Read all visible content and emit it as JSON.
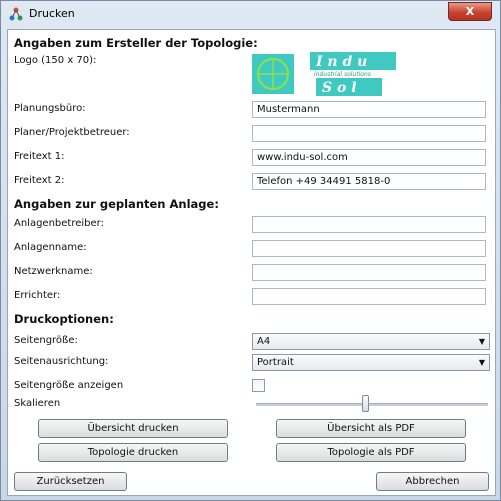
{
  "window": {
    "title": "Drucken",
    "close_label": "X"
  },
  "section_creator": "Angaben zum Ersteller der Topologie:",
  "logo_label": "Logo (150 x 70):",
  "logo": {
    "line1": "I n d u",
    "tagline": "industrial solutions",
    "line2": "S o l"
  },
  "creator_fields": [
    {
      "label": "Planungsbüro:",
      "value": "Mustermann"
    },
    {
      "label": "Planer/Projektbetreuer:",
      "value": ""
    },
    {
      "label": "Freitext 1:",
      "value": "www.indu-sol.com"
    },
    {
      "label": "Freitext 2:",
      "value": "Telefon +49 34491 5818-0"
    }
  ],
  "section_plant": "Angaben zur geplanten Anlage:",
  "plant_fields": [
    {
      "label": "Anlagenbetreiber:",
      "value": ""
    },
    {
      "label": "Anlagenname:",
      "value": ""
    },
    {
      "label": "Netzwerkname:",
      "value": ""
    },
    {
      "label": "Errichter:",
      "value": ""
    }
  ],
  "section_print": "Druckoptionen:",
  "page_size": {
    "label": "Seitengröße:",
    "value": "A4"
  },
  "orientation": {
    "label": "Seitenausrichtung:",
    "value": "Portrait"
  },
  "show_page_size": {
    "label": "Seitengröße anzeigen",
    "checked": false
  },
  "scale": {
    "label": "Skalieren",
    "value_fraction": 0.47
  },
  "buttons": {
    "overview_print": "Übersicht drucken",
    "overview_pdf": "Übersicht als PDF",
    "topology_print": "Topologie drucken",
    "topology_pdf": "Topologie als PDF",
    "reset": "Zurücksetzen",
    "cancel": "Abbrechen"
  },
  "colors": {
    "logo_bg": "#3fc9c0",
    "logo_text": "#ffffff",
    "close": "#c8432f"
  }
}
